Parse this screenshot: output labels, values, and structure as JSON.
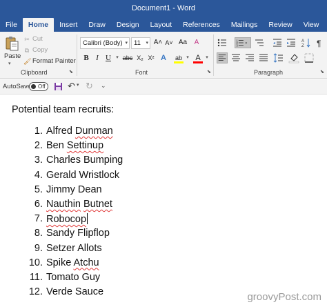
{
  "window": {
    "title": "Document1  -  Word"
  },
  "ribbon_tabs": [
    {
      "label": "File"
    },
    {
      "label": "Home"
    },
    {
      "label": "Insert"
    },
    {
      "label": "Draw"
    },
    {
      "label": "Design"
    },
    {
      "label": "Layout"
    },
    {
      "label": "References"
    },
    {
      "label": "Mailings"
    },
    {
      "label": "Review"
    },
    {
      "label": "View"
    }
  ],
  "active_tab": "Home",
  "clipboard": {
    "paste_label": "Paste",
    "cut_label": "Cut",
    "copy_label": "Copy",
    "format_painter_label": "Format Painter",
    "group_label": "Clipboard"
  },
  "font": {
    "family_value": "Calibri (Body)",
    "size_value": "11",
    "group_label": "Font",
    "bold": "B",
    "italic": "I",
    "underline": "U",
    "strike": "abc",
    "subscript": "X₂",
    "superscript": "X²",
    "text_effects": "A",
    "highlight": "ab",
    "font_color": "A",
    "grow": "A˄",
    "shrink": "A˅",
    "change_case": "Aa",
    "clear": "A"
  },
  "paragraph": {
    "group_label": "Paragraph"
  },
  "qat": {
    "autosave_label": "AutoSave",
    "autosave_state": "Off"
  },
  "document": {
    "heading": "Potential team recruits:",
    "list": [
      {
        "num": "1.",
        "text": "Alfred Dunman"
      },
      {
        "num": "2.",
        "text": "Ben Settinup"
      },
      {
        "num": "3.",
        "text": "Charles Bumping"
      },
      {
        "num": "4.",
        "text": "Gerald Wristlock"
      },
      {
        "num": "5.",
        "text": "Jimmy Dean"
      },
      {
        "num": "6.",
        "text": "Nauthin Butnet"
      },
      {
        "num": "7.",
        "text": "Robocop"
      },
      {
        "num": "8.",
        "text": "Sandy Flipflop"
      },
      {
        "num": "9.",
        "text": "Setzer Allots"
      },
      {
        "num": "10.",
        "text": "Spike Atchu"
      },
      {
        "num": "11.",
        "text": "Tomato Guy"
      },
      {
        "num": "12.",
        "text": "Verde Sauce"
      }
    ]
  },
  "watermark": "groovyPost.com",
  "colors": {
    "word_blue": "#2b579a",
    "ribbon_bg": "#f3f3f3",
    "spell_red": "#e03a3a",
    "highlight_yellow": "#ffff00",
    "font_red": "#ff0000"
  }
}
